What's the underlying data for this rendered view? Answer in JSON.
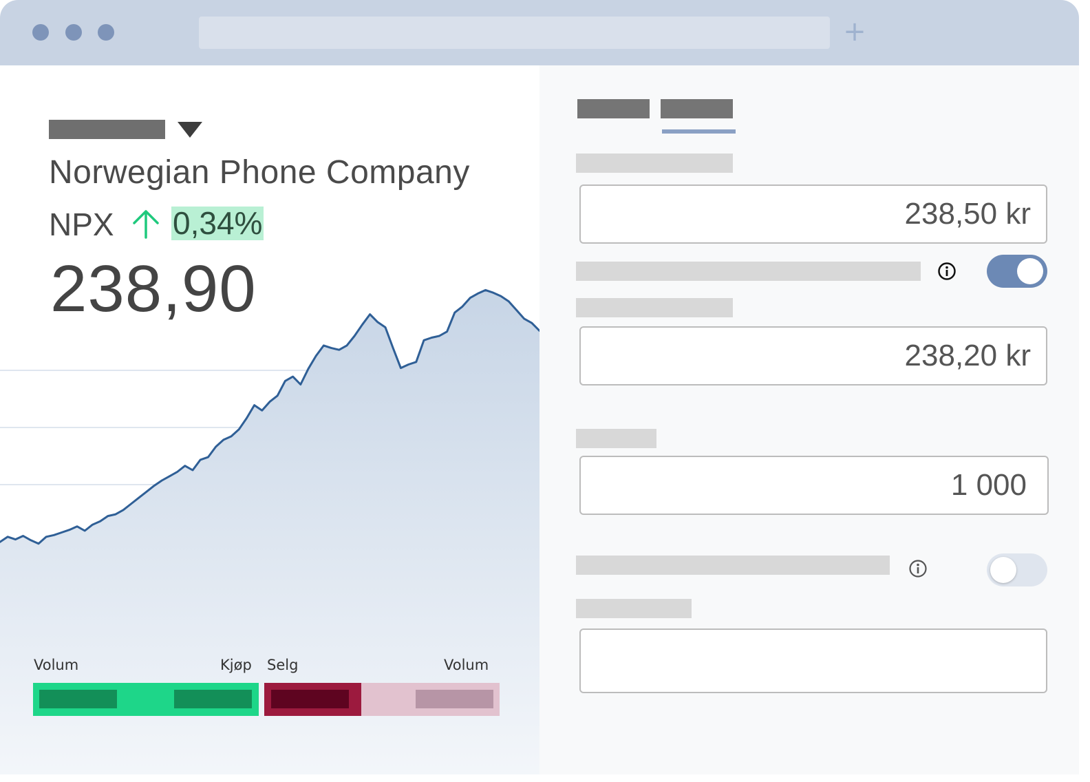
{
  "browser": {
    "new_tab_label": "+"
  },
  "stock": {
    "company_name": "Norwegian Phone Company",
    "ticker": "NPX",
    "change": "0,34%",
    "change_direction": "up",
    "price": "238,90"
  },
  "chart_data": {
    "type": "area",
    "series": [
      {
        "values": [
          207.2,
          207.8,
          207.5,
          207.9,
          207.4,
          207.0,
          207.8,
          208.0,
          208.3,
          208.6,
          209.0,
          208.5,
          209.2,
          209.6,
          210.2,
          210.4,
          210.9,
          211.6,
          212.3,
          213.0,
          213.7,
          214.3,
          214.8,
          215.3,
          216.0,
          215.5,
          216.7,
          217.0,
          218.2,
          219.0,
          219.4,
          220.2,
          221.5,
          223.0,
          222.4,
          223.4,
          224.1,
          225.8,
          226.3,
          225.4,
          227.2,
          228.7,
          229.9,
          229.6,
          229.4,
          229.9,
          231.0,
          232.3,
          233.5,
          232.6,
          232.0,
          229.6,
          227.3,
          227.7,
          228.0,
          230.5,
          230.8,
          231.0,
          231.5,
          233.7,
          234.4,
          235.4,
          235.9,
          236.3,
          236.0,
          235.6,
          235.0,
          234.0,
          233.0,
          232.5,
          231.6
        ]
      }
    ],
    "colors": {
      "line": "#2f5f96",
      "fill_top": "#c7d5e6",
      "fill_bottom": "#f3f6fa"
    }
  },
  "orderbook": {
    "buy_volume_label": "Volum",
    "buy_label": "Kjøp",
    "sell_label": "Selg",
    "sell_volume_label": "Volum",
    "colors": {
      "buy": "#1ed689",
      "buy_dark": "#138f58",
      "sell": "#9c1a3e",
      "sell_dark": "#5e0420",
      "sell_light": "#e2c2cf",
      "sell_light_dark": "#b795a6"
    }
  },
  "form": {
    "limit_price": "238,50 kr",
    "limit_toggle_on": true,
    "trigger_price": "238,20 kr",
    "quantity": "1 000",
    "second_toggle_on": false,
    "notes": "",
    "colors": {
      "toggle_on": "#6c89b5",
      "toggle_off": "#dfe5ee",
      "tab_underline": "#8aa0c4"
    }
  }
}
